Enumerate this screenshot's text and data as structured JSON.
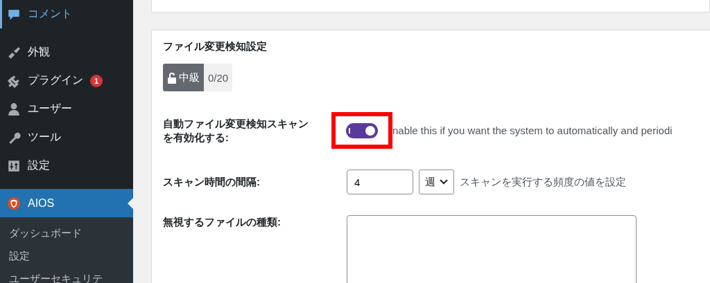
{
  "sidebar": {
    "items": [
      {
        "label": "コメント",
        "selected": false,
        "hover": true
      },
      {
        "label": "外観",
        "selected": false,
        "hover": false
      },
      {
        "label": "プラグイン",
        "selected": false,
        "hover": false,
        "badge": "1"
      },
      {
        "label": "ユーザー",
        "selected": false,
        "hover": false
      },
      {
        "label": "ツール",
        "selected": false,
        "hover": false
      },
      {
        "label": "設定",
        "selected": false,
        "hover": false
      },
      {
        "label": "AIOS",
        "selected": true,
        "hover": false
      }
    ],
    "submenu": [
      "ダッシュボード",
      "設定",
      "ユーザーセキュリテ"
    ]
  },
  "panel": {
    "title": "ファイル変更検知設定",
    "level_badge": {
      "label": "中級",
      "score": "0/20"
    },
    "rows": [
      {
        "kind": "toggle",
        "label": "自動ファイル変更検知スキャンを有効化する:",
        "on": true,
        "highlighted": true,
        "description": "nable this if you want the system to automatically and periodi"
      },
      {
        "kind": "interval",
        "label": "スキャン時間の間隔:",
        "value": "4",
        "unit": "週",
        "hint": "スキャンを実行する頻度の値を設定"
      },
      {
        "kind": "textarea",
        "label": "無視するファイルの種類:"
      }
    ]
  }
}
